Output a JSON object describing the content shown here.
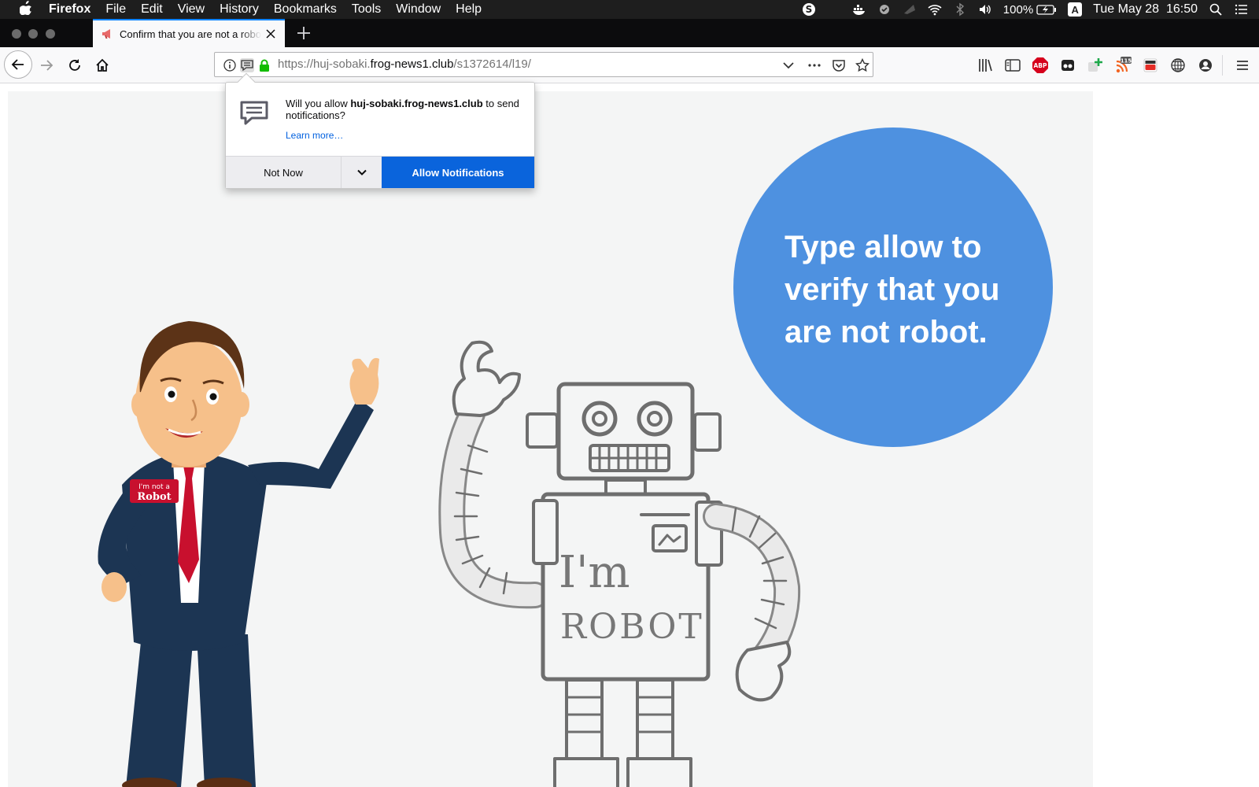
{
  "menubar": {
    "app_name": "Firefox",
    "items": [
      "File",
      "Edit",
      "View",
      "History",
      "Bookmarks",
      "Tools",
      "Window",
      "Help"
    ],
    "battery": "100%",
    "input_source": "A",
    "clock": "Tue May 28  16:50"
  },
  "tab": {
    "title": "Confirm that you are not a robot",
    "close_icon": "close-icon"
  },
  "url": {
    "scheme": "https://",
    "subdomain": "huj-sobaki.",
    "host": "frog-news1.club",
    "path": "/s1372614/l19/"
  },
  "toolbar": {
    "download_badge": "115",
    "adblock_label": "ABP"
  },
  "popup": {
    "message_prefix": "Will you allow ",
    "message_site": "huj-sobaki.frog-news1.club",
    "message_suffix": " to send notifications?",
    "learn_more": "Learn more…",
    "not_now": "Not Now",
    "allow": "Allow Notifications"
  },
  "page": {
    "bubble_text": "Type allow to verify that you are not robot.",
    "badge_line1": "I'm not a",
    "badge_line2": "Robot",
    "robot_text1": "I'm",
    "robot_text2": "ROBOT",
    "colors": {
      "bubble": "#4e91e0",
      "suit": "#1c3553",
      "tie": "#c8102e",
      "skin": "#f6c08a",
      "background": "#f4f5f5"
    }
  }
}
